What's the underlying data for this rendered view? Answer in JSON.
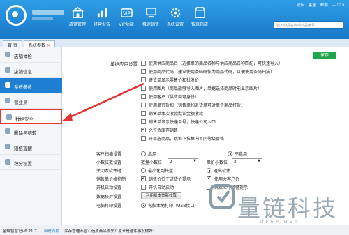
{
  "header": {
    "top_links": [
      "论坛",
      "客服",
      "帮助"
    ],
    "search_placeholder": "输入药品名称或药品编号",
    "nav": [
      {
        "label": "店铺管理",
        "icon": "shop-icon"
      },
      {
        "label": "经营报告",
        "icon": "report-icon"
      },
      {
        "label": "VIP功能",
        "icon": "vip-icon"
      },
      {
        "label": "极速销售",
        "icon": "fast-sale-icon"
      },
      {
        "label": "系统设置",
        "icon": "settings-icon"
      },
      {
        "label": "智慧药店",
        "icon": "smart-store-icon"
      }
    ]
  },
  "tabs": [
    {
      "label": "首 页"
    },
    {
      "label": "系统参数"
    }
  ],
  "sidebar": {
    "items": [
      {
        "label": "店铺体检"
      },
      {
        "label": "店铺信息"
      },
      {
        "label": "系统参数"
      },
      {
        "label": "营业员"
      },
      {
        "label": "数据安全"
      },
      {
        "label": "删除与结转"
      },
      {
        "label": "短信提醒"
      },
      {
        "label": "积分设置"
      }
    ]
  },
  "main": {
    "section_title": "单据应用设置",
    "save_label": "保存",
    "options": [
      {
        "label": "使用供应商品名（选择单的商品名称与供应商品名称匹配，可快速导入）",
        "checked": false
      },
      {
        "label": "使用商品代码（建议使用条码码作为商品代码，以便使用条码扫描）",
        "checked": false
      },
      {
        "label": "进货单显示零售价和批发价",
        "checked": false
      },
      {
        "label": "使用图片（商品能够导入图片，单据选择商品时能显示图片）",
        "checked": false
      },
      {
        "label": "使用客户（供应商可身份）",
        "checked": false
      },
      {
        "label": "使用单行折扣（销售单和退货单可对单个商品打折）",
        "checked": false
      },
      {
        "label": "销售单本次收款默认金额收款",
        "checked": false
      },
      {
        "label": "销售单显示快递单号，快递公司入口",
        "checked": false
      },
      {
        "label": "允许负库存销售",
        "checked": true
      },
      {
        "label": "开单选商品，跳框下拉框内不同等级价格",
        "checked": false
      }
    ],
    "client_scan": {
      "label": "客户扫描设置",
      "opt1": "启用",
      "opt2": "不启用"
    },
    "decimals": {
      "label": "小数位数设置",
      "qty_label": "数量小数位",
      "qty_value": "2",
      "price_label": "单价小数位",
      "price_value": "2"
    },
    "close_exit": {
      "label": "关闭本软件时",
      "opt1": "最小化到托盘",
      "opt2": "退出软件"
    },
    "price_check": {
      "label": "销售单价格控制",
      "opt1": "销售价低于进货价提示",
      "opt2": "使用大客户价"
    },
    "autostart": {
      "label": "开机启动设置",
      "opt1": "开机自动启动",
      "opt2": "开启库存预警提示"
    },
    "backup": {
      "label": "数据校对设置",
      "button": "利用版本重新校算"
    },
    "printer": {
      "label": "电脑打印设置",
      "opt1": "电脑本地打印（USB接口）"
    }
  },
  "statusbar": {
    "app_version": "金蝶智慧记V6.21.7",
    "message_label": "系统消息",
    "message": "库存管理不当？造成商品损失？原来是这件事没做好！"
  },
  "watermark": {
    "text": "量链科技",
    "sub": "QFSP.NET"
  },
  "colors": {
    "header_blue": "#1f86d8",
    "active_blue": "#1f7fd3",
    "save_green": "#22a64c",
    "highlight_red": "#e33333"
  }
}
